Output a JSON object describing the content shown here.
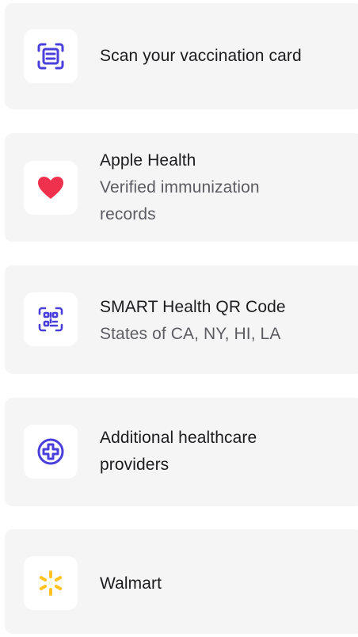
{
  "options": [
    {
      "title": "Scan your vaccination card",
      "subtitle": "",
      "icon": "scan-card-icon"
    },
    {
      "title": "Apple Health",
      "subtitle": "Verified immunization records",
      "icon": "heart-icon"
    },
    {
      "title": "SMART Health QR Code",
      "subtitle": "States of CA, NY, HI, LA",
      "icon": "qr-code-icon"
    },
    {
      "title": "Additional healthcare providers",
      "subtitle": "",
      "icon": "plus-circle-icon"
    },
    {
      "title": "Walmart",
      "subtitle": "",
      "icon": "walmart-spark-icon"
    }
  ],
  "colors": {
    "accent": "#4b3fdc",
    "heart": "#f0314d",
    "walmart_yellow": "#ffc220",
    "card_bg": "#f6f5f5"
  }
}
